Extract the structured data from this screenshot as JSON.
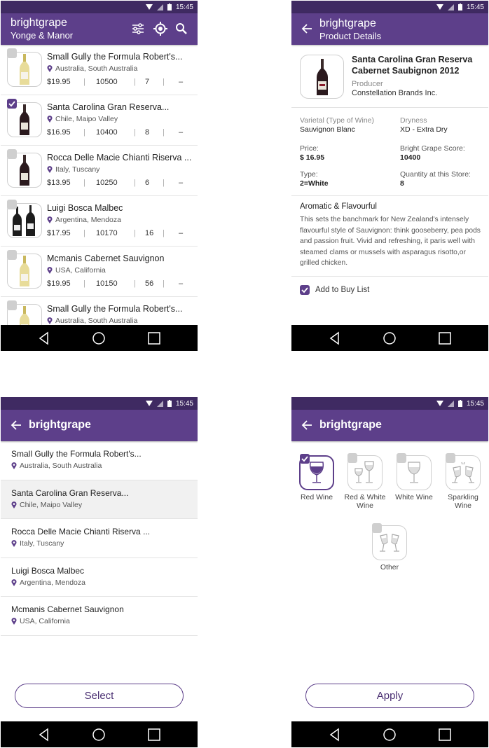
{
  "status": {
    "time": "15:45"
  },
  "brand": "brightgrape",
  "screen1": {
    "store": "Yonge & Manor",
    "wines": [
      {
        "name": "Small Gully the Formula Robert's...",
        "location": "Australia, South Australia",
        "price": "$19.95",
        "code": "10500",
        "qty": "7",
        "dash": "–",
        "checked": false,
        "bottle": "white"
      },
      {
        "name": "Santa Carolina Gran Reserva...",
        "location": "Chile, Maipo Valley",
        "price": "$16.95",
        "code": "10400",
        "qty": "8",
        "dash": "–",
        "checked": true,
        "bottle": "red"
      },
      {
        "name": "Rocca Delle Macie Chianti Riserva ...",
        "location": "Italy, Tuscany",
        "price": "$13.95",
        "code": "10250",
        "qty": "6",
        "dash": "–",
        "checked": false,
        "bottle": "red"
      },
      {
        "name": "Luigi Bosca Malbec",
        "location": "Argentina, Mendoza",
        "price": "$17.95",
        "code": "10170",
        "qty": "16",
        "dash": "–",
        "checked": false,
        "bottle": "pair"
      },
      {
        "name": "Mcmanis Cabernet Sauvignon",
        "location": "USA, California",
        "price": "$19.95",
        "code": "10150",
        "qty": "56",
        "dash": "–",
        "checked": false,
        "bottle": "white"
      },
      {
        "name": "Small Gully the Formula Robert's...",
        "location": "Australia, South Australia",
        "price": "",
        "code": "",
        "qty": "",
        "dash": "",
        "checked": false,
        "bottle": "white"
      }
    ]
  },
  "screen2": {
    "title": "Product Details",
    "product_name": "Santa Carolina Gran Reserva Cabernet Saubignon 2012",
    "producer_label": "Producer",
    "producer": "Constellation Brands Inc.",
    "varietal_label": "Varietal (Type of Wine)",
    "varietal": "Sauvignon Blanc",
    "dryness_label": "Dryness",
    "dryness": "XD - Extra Dry",
    "price_label": "Price:",
    "price": "$ 16.95",
    "score_label": "Bright Grape Score:",
    "score": "10400",
    "type_label": "Type:",
    "type": "2=White",
    "quantity_label": "Quantity at this Store:",
    "quantity": "8",
    "aroma_heading": "Aromatic & Flavourful",
    "aroma_text": "This sets the banchmark for New Zealand's intensely flavourful style of Sauvignon: think gooseberry, pea pods and passion fruit. Vivid and refreshing, it paris well with steamed clams or mussels with asparagus risotto,or grilled chicken.",
    "buy_list_label": "Add to Buy List",
    "buy_list_checked": true
  },
  "screen3": {
    "stores": [
      {
        "name": "Small Gully the Formula Robert's...",
        "location": "Australia, South Australia",
        "selected": false
      },
      {
        "name": "Santa Carolina Gran Reserva...",
        "location": "Chile, Maipo Valley",
        "selected": true
      },
      {
        "name": "Rocca Delle Macie Chianti Riserva ...",
        "location": "Italy, Tuscany",
        "selected": false
      },
      {
        "name": "Luigi Bosca Malbec",
        "location": "Argentina, Mendoza",
        "selected": false
      },
      {
        "name": "Mcmanis Cabernet Sauvignon",
        "location": "USA, California",
        "selected": false
      }
    ],
    "select_label": "Select"
  },
  "screen4": {
    "types": [
      {
        "label": "Red Wine",
        "icon": "red-wine-glass-icon",
        "checked": true
      },
      {
        "label": "Red & White Wine",
        "icon": "red-white-wine-icon",
        "checked": false
      },
      {
        "label": "White Wine",
        "icon": "white-wine-glass-icon",
        "checked": false
      },
      {
        "label": "Sparkling Wine",
        "icon": "sparkling-wine-icon",
        "checked": false
      },
      {
        "label": "Other",
        "icon": "other-wine-icon",
        "checked": false
      }
    ],
    "apply_label": "Apply"
  },
  "colors": {
    "accent": "#5d3f8a",
    "statusbar": "#3f2a62",
    "navbar": "#000000"
  }
}
